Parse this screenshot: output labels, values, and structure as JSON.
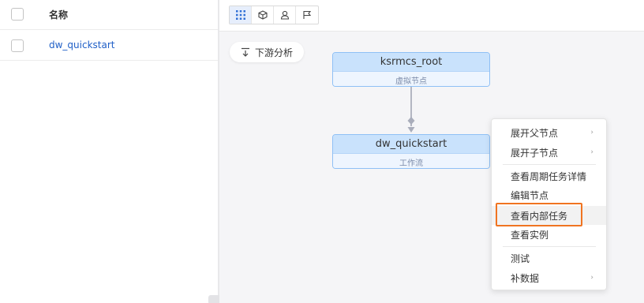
{
  "table": {
    "header_name": "名称",
    "rows": [
      {
        "name": "dw_quickstart"
      }
    ]
  },
  "toolbar": {
    "tools": [
      {
        "icon": "grid-icon",
        "active": true
      },
      {
        "icon": "cube-icon",
        "active": false
      },
      {
        "icon": "user-icon",
        "active": false
      },
      {
        "icon": "flag-icon",
        "active": false
      }
    ]
  },
  "downstream": {
    "label": "下游分析",
    "icon": "download-analysis-icon"
  },
  "nodes": {
    "root": {
      "name": "ksrmcs_root",
      "type": "虚拟节点"
    },
    "dw": {
      "name": "dw_quickstart",
      "type": "工作流"
    }
  },
  "context_menu": {
    "items": [
      {
        "label": "展开父节点",
        "has_submenu": true
      },
      {
        "label": "展开子节点",
        "has_submenu": true
      },
      {
        "label": "查看周期任务详情",
        "has_submenu": false
      },
      {
        "label": "编辑节点",
        "has_submenu": false
      },
      {
        "label": "查看内部任务",
        "has_submenu": false,
        "highlighted": true
      },
      {
        "label": "查看实例",
        "has_submenu": false
      },
      {
        "label": "测试",
        "has_submenu": false
      },
      {
        "label": "补数据",
        "has_submenu": true
      }
    ]
  },
  "colors": {
    "accent_link": "#1f5fc7",
    "node_border": "#8fc0f5",
    "highlight": "#f07421"
  }
}
